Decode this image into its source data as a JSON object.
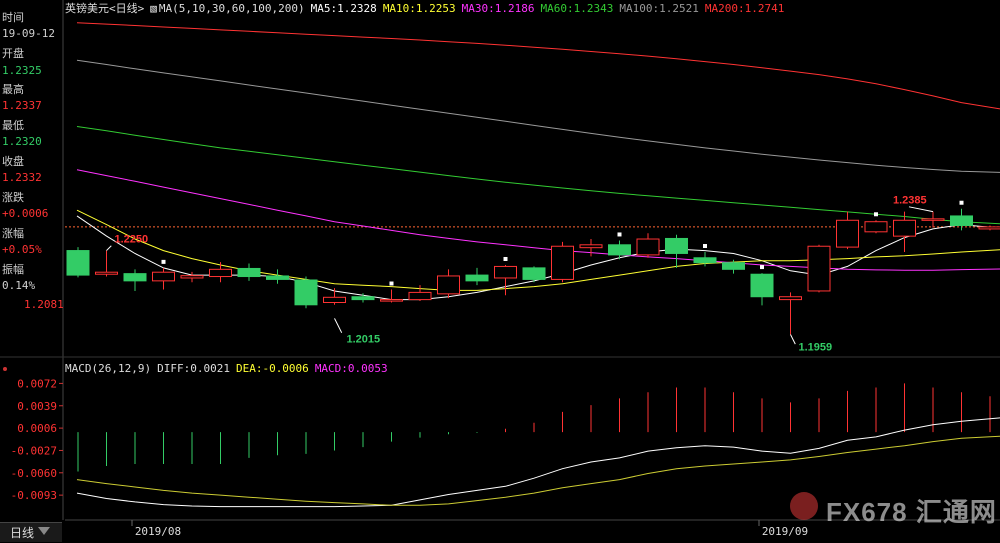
{
  "sidebar": {
    "time_label": "时间",
    "time_value": "19-09-12",
    "open_label": "开盘",
    "open_value": "1.2325",
    "high_label": "最高",
    "high_value": "1.2337",
    "low_label": "最低",
    "low_value": "1.2320",
    "close_label": "收盘",
    "close_value": "1.2332",
    "change_label": "涨跌",
    "change_value": "+0.0006",
    "pct_label": "涨幅",
    "pct_value": "+0.05%",
    "amp_label": "振幅",
    "amp_value": "0.14%",
    "price_tick": "1.2081"
  },
  "legend": {
    "title": "英镑美元<日线>",
    "ma_params": "MA(5,10,30,60,100,200)",
    "ma5": "MA5:1.2328",
    "ma10": "MA10:1.2253",
    "ma30": "MA30:1.2186",
    "ma60": "MA60:1.2343",
    "ma100": "MA100:1.2521",
    "ma200": "MA200:1.2741"
  },
  "macd_legend": {
    "params": "MACD(26,12,9)",
    "diff": "DIFF:0.0021",
    "dea": "DEA:-0.0006",
    "macd": "MACD:0.0053"
  },
  "tab": {
    "label": "日线"
  },
  "watermark": {
    "text": "FX678 汇通网"
  },
  "colors": {
    "up": "#ff3333",
    "down": "#33cc66",
    "ma5": "#ffffff",
    "ma10": "#ffff33",
    "ma30": "#ff33ff",
    "ma60": "#33cc33",
    "ma100": "#999999",
    "ma200": "#ff3333",
    "dea": "#cccc33"
  },
  "chart_data": [
    {
      "type": "candlestick",
      "x_labels": [
        "2019/08",
        "2019/09"
      ],
      "annotations": [
        {
          "text": "1.2250",
          "value": 1.225
        },
        {
          "text": "1.2015",
          "value": 1.2015
        },
        {
          "text": "1.1959",
          "value": 1.1959
        },
        {
          "text": "1.2385",
          "value": 1.2385
        }
      ],
      "y_tick": "1.2081",
      "reference_price": 1.2332,
      "candles": [
        {
          "o": 1.225,
          "h": 1.2262,
          "l": 1.2157,
          "c": 1.2165
        },
        {
          "o": 1.2168,
          "h": 1.225,
          "l": 1.216,
          "c": 1.2175
        },
        {
          "o": 1.217,
          "h": 1.2185,
          "l": 1.211,
          "c": 1.2145
        },
        {
          "o": 1.2145,
          "h": 1.219,
          "l": 1.2115,
          "c": 1.2175
        },
        {
          "o": 1.2155,
          "h": 1.2176,
          "l": 1.214,
          "c": 1.2163
        },
        {
          "o": 1.216,
          "h": 1.221,
          "l": 1.214,
          "c": 1.2185
        },
        {
          "o": 1.2188,
          "h": 1.2205,
          "l": 1.2145,
          "c": 1.216
        },
        {
          "o": 1.2162,
          "h": 1.2185,
          "l": 1.2135,
          "c": 1.215
        },
        {
          "o": 1.2148,
          "h": 1.216,
          "l": 1.205,
          "c": 1.2062
        },
        {
          "o": 1.207,
          "h": 1.212,
          "l": 1.2062,
          "c": 1.2088
        },
        {
          "o": 1.209,
          "h": 1.2102,
          "l": 1.207,
          "c": 1.208
        },
        {
          "o": 1.2075,
          "h": 1.2115,
          "l": 1.207,
          "c": 1.208
        },
        {
          "o": 1.208,
          "h": 1.213,
          "l": 1.2075,
          "c": 1.2105
        },
        {
          "o": 1.21,
          "h": 1.2185,
          "l": 1.2085,
          "c": 1.2162
        },
        {
          "o": 1.2165,
          "h": 1.219,
          "l": 1.213,
          "c": 1.2145
        },
        {
          "o": 1.2155,
          "h": 1.22,
          "l": 1.2095,
          "c": 1.2195
        },
        {
          "o": 1.219,
          "h": 1.2195,
          "l": 1.214,
          "c": 1.215
        },
        {
          "o": 1.215,
          "h": 1.228,
          "l": 1.214,
          "c": 1.2265
        },
        {
          "o": 1.226,
          "h": 1.229,
          "l": 1.223,
          "c": 1.227
        },
        {
          "o": 1.227,
          "h": 1.2285,
          "l": 1.222,
          "c": 1.2235
        },
        {
          "o": 1.2235,
          "h": 1.231,
          "l": 1.2225,
          "c": 1.229
        },
        {
          "o": 1.2292,
          "h": 1.2305,
          "l": 1.219,
          "c": 1.224
        },
        {
          "o": 1.2225,
          "h": 1.2245,
          "l": 1.2195,
          "c": 1.2208
        },
        {
          "o": 1.2208,
          "h": 1.2218,
          "l": 1.217,
          "c": 1.2185
        },
        {
          "o": 1.2168,
          "h": 1.2172,
          "l": 1.206,
          "c": 1.209
        },
        {
          "o": 1.208,
          "h": 1.2105,
          "l": 1.1959,
          "c": 1.209
        },
        {
          "o": 1.211,
          "h": 1.227,
          "l": 1.2105,
          "c": 1.2265
        },
        {
          "o": 1.2262,
          "h": 1.2385,
          "l": 1.2255,
          "c": 1.2355
        },
        {
          "o": 1.2315,
          "h": 1.2355,
          "l": 1.231,
          "c": 1.235
        },
        {
          "o": 1.23,
          "h": 1.2385,
          "l": 1.2245,
          "c": 1.2355
        },
        {
          "o": 1.2355,
          "h": 1.2385,
          "l": 1.233,
          "c": 1.236
        },
        {
          "o": 1.237,
          "h": 1.2395,
          "l": 1.232,
          "c": 1.2337
        },
        {
          "o": 1.2325,
          "h": 1.2337,
          "l": 1.232,
          "c": 1.2332
        }
      ],
      "ma_series": [
        {
          "name": "MA5",
          "values": [
            1.237,
            1.23,
            1.224,
            1.219,
            1.2165,
            1.2165,
            1.2165,
            1.216,
            1.214,
            1.211,
            1.2095,
            1.208,
            1.208,
            1.209,
            1.2105,
            1.2125,
            1.2145,
            1.217,
            1.22,
            1.2225,
            1.2245,
            1.2255,
            1.225,
            1.224,
            1.2215,
            1.218,
            1.2165,
            1.2195,
            1.225,
            1.2295,
            1.2325,
            1.234,
            1.2328
          ]
        },
        {
          "name": "MA10",
          "values": [
            1.239,
            1.234,
            1.229,
            1.225,
            1.2222,
            1.22,
            1.218,
            1.2165,
            1.215,
            1.2135,
            1.213,
            1.2125,
            1.2118,
            1.2112,
            1.2112,
            1.2118,
            1.2125,
            1.2135,
            1.215,
            1.2165,
            1.218,
            1.2195,
            1.2205,
            1.221,
            1.2215,
            1.2215,
            1.2218,
            1.2222,
            1.2228,
            1.2232,
            1.2238,
            1.2245,
            1.2253
          ]
        },
        {
          "name": "MA30",
          "values": [
            1.253,
            1.251,
            1.249,
            1.247,
            1.245,
            1.243,
            1.241,
            1.239,
            1.237,
            1.235,
            1.2335,
            1.232,
            1.2305,
            1.2292,
            1.228,
            1.227,
            1.226,
            1.225,
            1.2243,
            1.2235,
            1.2228,
            1.2222,
            1.2215,
            1.2208,
            1.22,
            1.2195,
            1.219,
            1.2185,
            1.2183,
            1.2182,
            1.2182,
            1.2184,
            1.2186
          ]
        },
        {
          "name": "MA60",
          "values": [
            1.268,
            1.2665,
            1.265,
            1.2635,
            1.262,
            1.2606,
            1.2594,
            1.2582,
            1.257,
            1.2558,
            1.2546,
            1.2534,
            1.2522,
            1.251,
            1.2498,
            1.2487,
            1.2477,
            1.2467,
            1.2457,
            1.2448,
            1.244,
            1.2432,
            1.2424,
            1.2416,
            1.2408,
            1.24,
            1.2392,
            1.2384,
            1.2376,
            1.2368,
            1.2358,
            1.235,
            1.2343
          ]
        },
        {
          "name": "MA100",
          "values": [
            1.291,
            1.2895,
            1.288,
            1.2866,
            1.2852,
            1.2838,
            1.2824,
            1.281,
            1.2796,
            1.2782,
            1.2768,
            1.2754,
            1.274,
            1.2726,
            1.2712,
            1.2698,
            1.2684,
            1.267,
            1.2656,
            1.2643,
            1.263,
            1.2618,
            1.2606,
            1.2595,
            1.2584,
            1.2574,
            1.2564,
            1.2555,
            1.2546,
            1.2538,
            1.2531,
            1.2525,
            1.2521
          ]
        },
        {
          "name": "MA200",
          "values": [
            1.304,
            1.3035,
            1.303,
            1.3025,
            1.302,
            1.3015,
            1.301,
            1.3005,
            1.3,
            1.2995,
            1.299,
            1.2985,
            1.298,
            1.2974,
            1.2968,
            1.2962,
            1.2955,
            1.2948,
            1.294,
            1.2932,
            1.2924,
            1.2915,
            1.2905,
            1.2895,
            1.2884,
            1.2872,
            1.286,
            1.2845,
            1.2828,
            1.2808,
            1.2786,
            1.2763,
            1.2741
          ]
        }
      ]
    },
    {
      "type": "macd",
      "y_ticks": [
        "0.0072",
        "0.0039",
        "0.0006",
        "-0.0027",
        "-0.0060",
        "-0.0093"
      ],
      "y_tick_values": [
        0.0072,
        0.0039,
        0.0006,
        -0.0027,
        -0.006,
        -0.0093
      ],
      "macd_bars": [
        -0.0058,
        -0.005,
        -0.0047,
        -0.0047,
        -0.0047,
        -0.0047,
        -0.0038,
        -0.0034,
        -0.0032,
        -0.0027,
        -0.0022,
        -0.0014,
        -0.0008,
        -0.0003,
        -0.0001,
        0.0005,
        0.0014,
        0.003,
        0.004,
        0.005,
        0.0059,
        0.0066,
        0.0066,
        0.0059,
        0.005,
        0.0044,
        0.005,
        0.0061,
        0.0066,
        0.0072,
        0.0066,
        0.0059,
        0.0053
      ],
      "diff": [
        -0.009,
        -0.0098,
        -0.0103,
        -0.0107,
        -0.0109,
        -0.011,
        -0.011,
        -0.011,
        -0.011,
        -0.011,
        -0.0109,
        -0.0108,
        -0.01,
        -0.0092,
        -0.0086,
        -0.008,
        -0.0068,
        -0.0054,
        -0.0044,
        -0.0038,
        -0.0028,
        -0.0023,
        -0.002,
        -0.0022,
        -0.0028,
        -0.0031,
        -0.0024,
        -0.0012,
        -0.0007,
        0.0003,
        0.0011,
        0.0016,
        0.0021
      ],
      "dea": [
        -0.007,
        -0.0076,
        -0.0081,
        -0.0086,
        -0.009,
        -0.0093,
        -0.0096,
        -0.0099,
        -0.0102,
        -0.0104,
        -0.0106,
        -0.0108,
        -0.0108,
        -0.0106,
        -0.0101,
        -0.0096,
        -0.009,
        -0.0082,
        -0.0076,
        -0.007,
        -0.0061,
        -0.0054,
        -0.005,
        -0.0047,
        -0.0044,
        -0.0041,
        -0.0036,
        -0.003,
        -0.0025,
        -0.002,
        -0.0014,
        -0.0009,
        -0.0006
      ]
    }
  ]
}
